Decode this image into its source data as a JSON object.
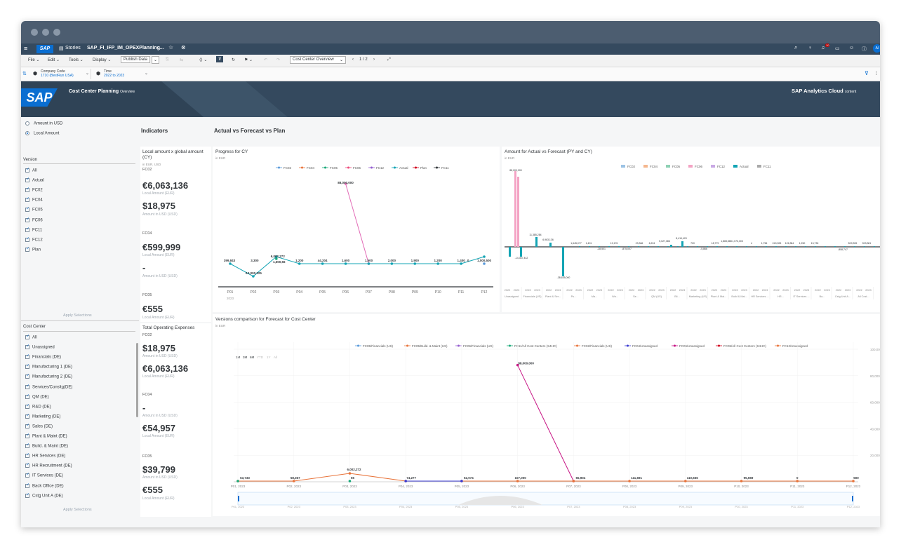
{
  "shell": {
    "stories": "Stories",
    "doc_title": "SAP_FI_IFP_IM_OPEXPlanning...",
    "avatar": "AI",
    "notif_count": "10"
  },
  "toolbar": {
    "file": "File",
    "edit": "Edit",
    "tools": "Tools",
    "display": "Display",
    "publish": "Publish Data",
    "page_select": "Cost Center Overview",
    "page_num": "1 / 2"
  },
  "filters": {
    "company_label": "Company Code",
    "company_value": "1710 (BestRun USA)",
    "time_label": "Time",
    "time_value": "2022 to 2023"
  },
  "banner": {
    "logo": "SAP",
    "title": "Cost Center Planning",
    "title_suffix": "Overview",
    "right_title": "SAP Analytics Cloud",
    "right_suffix": "content"
  },
  "left": {
    "amount_usd": "Amount in USD",
    "local_amount": "Local Amount",
    "version_title": "Version",
    "versions": [
      "All",
      "Actual",
      "FC02",
      "FC04",
      "FC05",
      "FC06",
      "FC11",
      "FC12",
      "Plan"
    ],
    "apply": "Apply Selections",
    "costcenter_title": "Cost Center",
    "costcenters": [
      "All",
      "Unassigned",
      "Financials (DE)",
      "Manufacturing 1 (DE)",
      "Manufacturing 2 (DE)",
      "Services/Consltg(DE)",
      "QM (DE)",
      "R&D (DE)",
      "Marketing (DE)",
      "Sales (DE)",
      "Plant & Maint (DE)",
      "Build. & Maint (DE)",
      "HR Services (DE)",
      "HR Recruitment (DE)",
      "IT Services (DE)",
      "Back Office (DE)",
      "Cstg Unit A (DE)"
    ],
    "apply2": "Apply Selections"
  },
  "headers": {
    "indicators": "Indicators",
    "avf": "Actual vs Forecast vs Plan"
  },
  "kpi1": {
    "title": "Local amount x global amount (CY)",
    "unit": "in EUR, USD",
    "fc02": "FC02",
    "v1": "€6,063,136",
    "l1": "Local Amount (EUR)",
    "v2": "$18,975",
    "l2": "Amount in USD (USD)",
    "fc04": "FC04",
    "v3": "€599,999",
    "l3": "Local Amount (EUR)",
    "v4": "-",
    "l4": "Amount in USD (USD)",
    "fc05": "FC05",
    "v5": "€555",
    "l5": "Local Amount (EUR)"
  },
  "kpi2": {
    "title": "Total Operating Expenses",
    "fc02": "FC02",
    "v1": "$18,975",
    "l1": "Amount in USD (USD)",
    "v2": "€6,063,136",
    "l2": "Local Amount (EUR)",
    "fc04": "FC04",
    "v3": "-",
    "l3": "Amount in USD (USD)",
    "v4": "€54,957",
    "l4": "Local Amount (EUR)",
    "fc05": "FC05",
    "v5": "$39,799",
    "l5": "Amount in USD (USD)",
    "v6": "€555",
    "l6": "Local Amount (EUR)"
  },
  "chart_data": [
    {
      "type": "line",
      "title": "Progress for CY",
      "unit": "in EUR",
      "legend": [
        "FC02",
        "FC04",
        "FC05",
        "FC06",
        "FC12",
        "Actual",
        "Plan",
        "FC11"
      ],
      "legend_colors": [
        "#5899da",
        "#e8743b",
        "#19a979",
        "#ed4a7b",
        "#945ecf",
        "#13a4b4",
        "#d0021b",
        "#32363a"
      ],
      "categories": [
        "P01",
        "P02",
        "P03",
        "P04",
        "P05",
        "P06",
        "P07",
        "P08",
        "P09",
        "P10",
        "P11",
        "P12"
      ],
      "year": "2023",
      "series": [
        {
          "name": "FC06",
          "color": "#e26ab6",
          "values": [
            null,
            null,
            null,
            null,
            null,
            88000000,
            1500,
            null,
            null,
            null,
            null,
            null
          ]
        },
        {
          "name": "Actual",
          "color": "#13a4b4",
          "values": [
            399843,
            -13000325,
            6002272,
            1200,
            44204,
            1600,
            1500,
            2000,
            1900,
            1200,
            1400,
            1000500
          ]
        }
      ],
      "labels": [
        "399,843",
        "-13,000,325",
        "6,002,272",
        "3,300",
        "1,600,56",
        "1,200",
        "44,204",
        "1,600",
        "1,500",
        "2,000",
        "1,900",
        "1,200",
        "1,400",
        "0",
        "1,000,500",
        "88,000,000"
      ]
    },
    {
      "type": "bar",
      "title": "Amount for Actual vs Forecast (PY and CY)",
      "unit": "in EUR",
      "legend": [
        "FC02",
        "FC04",
        "FC05",
        "FC06",
        "FC12",
        "Actual",
        "FC11"
      ],
      "legend_colors": [
        "#9cc3e5",
        "#f5b78e",
        "#8ed1b4",
        "#f4a3c4",
        "#c9a9e5",
        "#13a4b4",
        "#a9a9a9"
      ],
      "categories": [
        "Unassigned",
        "Financials (US)",
        "Plant & Ser...",
        "Pu...",
        "Ma...",
        "Wa...",
        "Se...",
        "QM (US)",
        "Bli...",
        "Marketing (US)",
        "Plant & Mai...",
        "Build & Mai...",
        "HR Services ...",
        "HR...",
        "IT Services ...",
        "Ba...",
        "Cstg Unit A...",
        "All Cost..."
      ],
      "value_labels": [
        "88,000,000",
        "-14,367,442",
        "11,385,284",
        "6,963,136",
        "-38,635,000",
        "1,645,077",
        "1,401",
        "-28,501",
        "19,176",
        "-875,007",
        "23,366",
        "6,224",
        "5,027,386",
        "8,419,420",
        "720",
        "-5,866",
        "18,779",
        "1,883,888",
        "1,073,303",
        "4",
        "1,756",
        "240,395",
        "126,384",
        "1,250",
        "13,730",
        "-858,747",
        "509,335",
        "903,381"
      ],
      "ylim": [
        -40000000,
        90000000
      ]
    },
    {
      "type": "line",
      "title": "Versions comparison for Forecast for Cost Center",
      "unit": "in EUR",
      "legend": [
        "FC05/Financials (US)",
        "FC05/Build. & Maint (US)",
        "FC06/Financials (US)",
        "FC11/All Cost Centers (S4HC)",
        "FC02/Financials (US)",
        "FC04/Unassigned",
        "FC06/Unassigned",
        "FC05/All Cost Centers (S4HC)",
        "FC12/Unassigned"
      ],
      "legend_colors": [
        "#5899da",
        "#e8743b",
        "#945ecf",
        "#19a979",
        "#e8743b",
        "#3b3bd1",
        "#c71585",
        "#d0021b",
        "#e8743b"
      ],
      "range_buttons": [
        "1M",
        "3M",
        "6M",
        "YTD",
        "1Y",
        "All"
      ],
      "categories": [
        "P01, 2023",
        "P02, 2023",
        "P03, 2023",
        "P04, 2023",
        "P05, 2023",
        "P06, 2023",
        "P07, 2023",
        "P08, 2023",
        "P09, 2023",
        "P10, 2023",
        "P11, 2023",
        "P12, 2023"
      ],
      "yticks": [
        "100,000,000",
        "80,000,000",
        "60,000,000",
        "40,000,000",
        "20,000,000"
      ],
      "ylim": [
        0,
        100000000
      ],
      "series": [
        {
          "name": "FC06/Unassigned",
          "color": "#c71585",
          "values": [
            null,
            null,
            null,
            null,
            null,
            88000000,
            65904,
            null,
            null,
            null,
            null,
            null
          ]
        },
        {
          "name": "FC02/Financials (US)",
          "color": "#e8743b",
          "values": [
            63733,
            58367,
            6002272,
            74277,
            52074,
            107000,
            65904,
            111691,
            110656,
            95669,
            0,
            500
          ]
        },
        {
          "name": "FC04/Unassigned",
          "color": "#3b3bd1",
          "values": [
            null,
            null,
            null,
            74277,
            52074,
            null,
            null,
            null,
            null,
            null,
            null,
            null
          ]
        }
      ],
      "point_labels": [
        "63,733",
        "58,367",
        "6,002,272",
        "55",
        "74,277",
        "52,074",
        "107,000",
        "65,904",
        "111,691",
        "110,656",
        "95,669",
        "0",
        "500",
        "88,000,000"
      ]
    }
  ]
}
